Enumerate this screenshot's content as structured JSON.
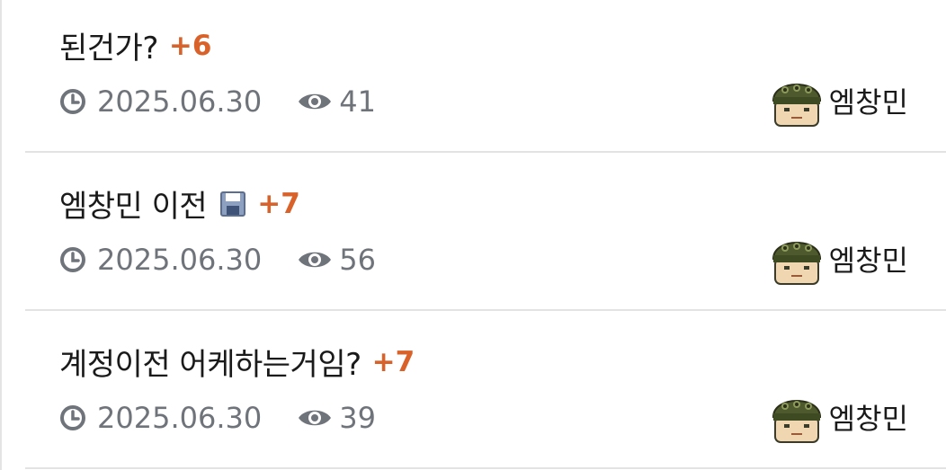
{
  "posts": [
    {
      "title": "된건가?",
      "has_save_icon": false,
      "comment_count": "+6",
      "date": "2025.06.30",
      "views": "41",
      "author": "엠창민"
    },
    {
      "title": "엠창민 이전",
      "has_save_icon": true,
      "comment_count": "+7",
      "date": "2025.06.30",
      "views": "56",
      "author": "엠창민"
    },
    {
      "title": "계정이전 어케하는거임?",
      "has_save_icon": false,
      "comment_count": "+7",
      "date": "2025.06.30",
      "views": "39",
      "author": "엠창민"
    }
  ],
  "colors": {
    "comment_count": "#d9622b",
    "meta_text": "#6f737a",
    "divider": "#e3e3e3"
  },
  "icons": {
    "date": "clock-icon",
    "views": "eye-icon",
    "attachment": "save-icon",
    "avatar": "soldier-avatar"
  }
}
